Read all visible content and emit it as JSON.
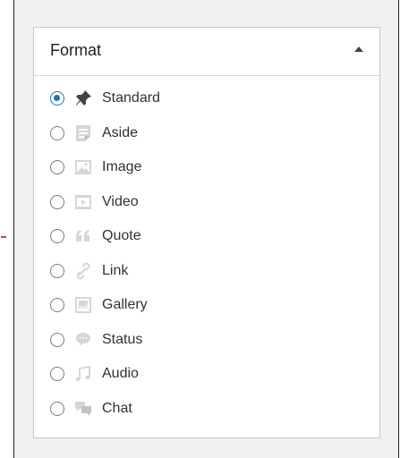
{
  "panel": {
    "title": "Format",
    "toggle_icon": "triangle-up-icon"
  },
  "formats": [
    {
      "label": "Standard",
      "icon": "pin-icon",
      "selected": true
    },
    {
      "label": "Aside",
      "icon": "aside-icon",
      "selected": false
    },
    {
      "label": "Image",
      "icon": "image-icon",
      "selected": false
    },
    {
      "label": "Video",
      "icon": "video-icon",
      "selected": false
    },
    {
      "label": "Quote",
      "icon": "quote-icon",
      "selected": false
    },
    {
      "label": "Link",
      "icon": "link-icon",
      "selected": false
    },
    {
      "label": "Gallery",
      "icon": "gallery-icon",
      "selected": false
    },
    {
      "label": "Status",
      "icon": "status-icon",
      "selected": false
    },
    {
      "label": "Audio",
      "icon": "audio-icon",
      "selected": false
    },
    {
      "label": "Chat",
      "icon": "chat-icon",
      "selected": false
    }
  ],
  "colors": {
    "radio_checked": "#2271b1",
    "icon_muted": "#d6d6d6",
    "icon_active": "#444444"
  }
}
